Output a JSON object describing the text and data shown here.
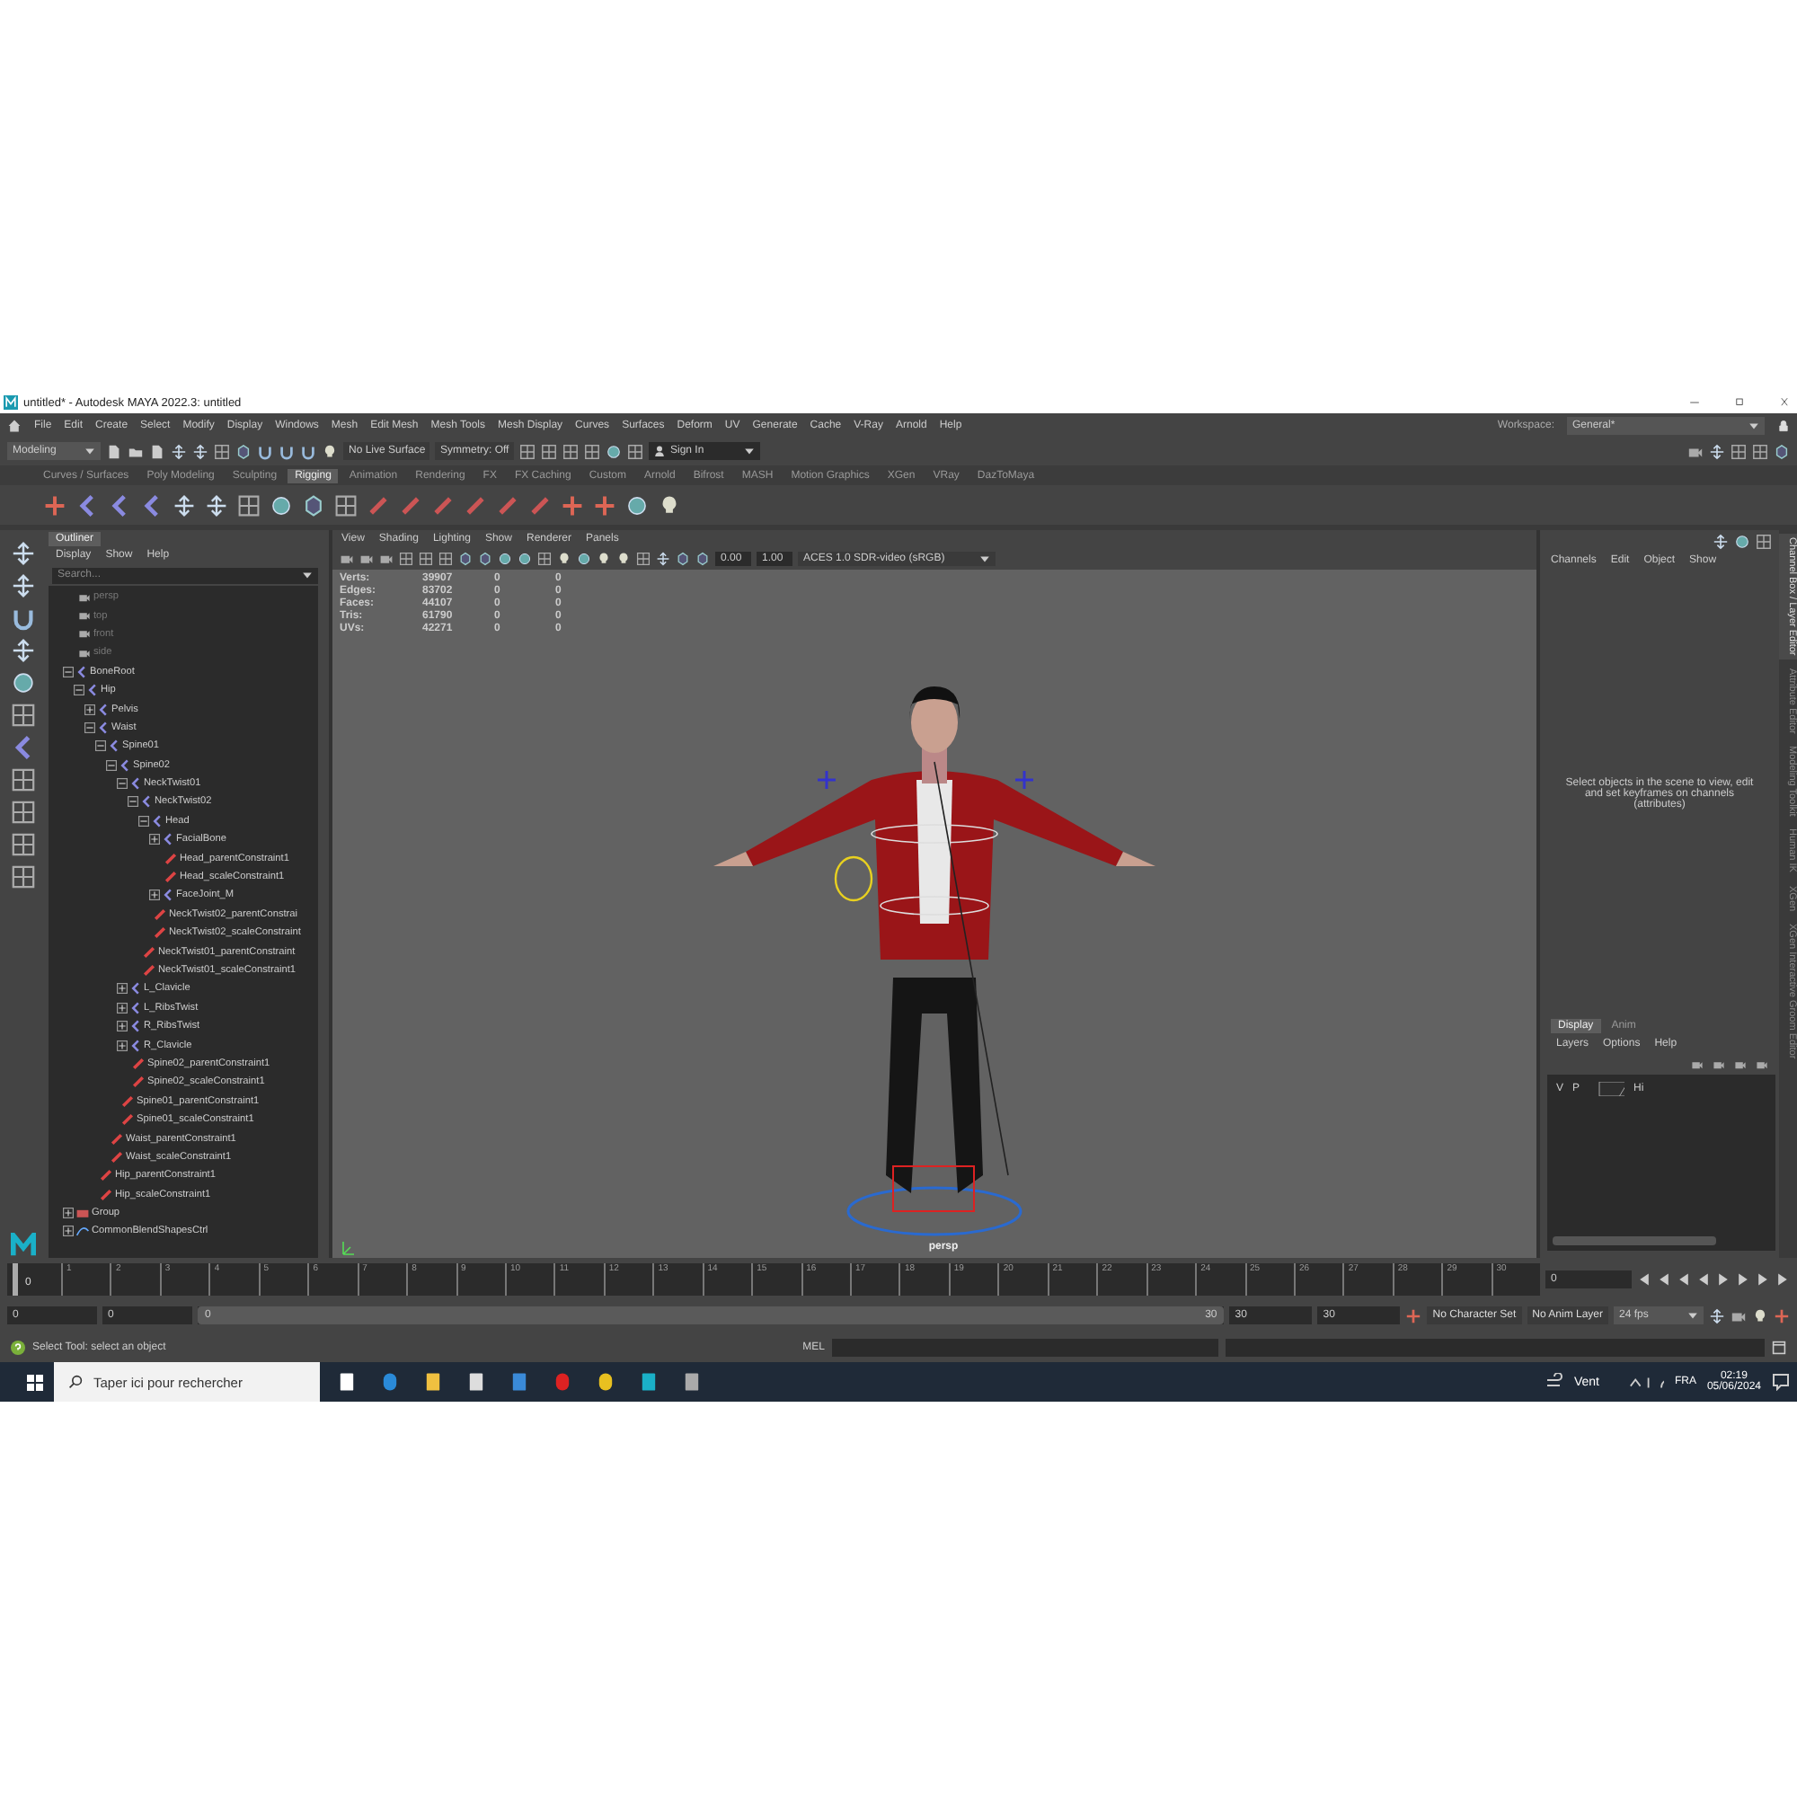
{
  "window": {
    "title": "untitled* - Autodesk MAYA 2022.3: untitled"
  },
  "menu_bar": [
    "File",
    "Edit",
    "Create",
    "Select",
    "Modify",
    "Display",
    "Windows",
    "Mesh",
    "Edit Mesh",
    "Mesh Tools",
    "Mesh Display",
    "Curves",
    "Surfaces",
    "Deform",
    "UV",
    "Generate",
    "Cache",
    "V-Ray",
    "Arnold",
    "Help"
  ],
  "workspace": {
    "label": "Workspace:",
    "value": "General*"
  },
  "status_line": {
    "menu_set": "Modeling",
    "live_surface": "No Live Surface",
    "symmetry": "Symmetry: Off",
    "sign_in": "Sign In"
  },
  "shelf_tabs": [
    {
      "label": "Curves / Surfaces",
      "selected": false
    },
    {
      "label": "Poly Modeling",
      "selected": false
    },
    {
      "label": "Sculpting",
      "selected": false
    },
    {
      "label": "Rigging",
      "selected": true
    },
    {
      "label": "Animation",
      "selected": false
    },
    {
      "label": "Rendering",
      "selected": false
    },
    {
      "label": "FX",
      "selected": false
    },
    {
      "label": "FX Caching",
      "selected": false
    },
    {
      "label": "Custom",
      "selected": false
    },
    {
      "label": "Arnold",
      "selected": false
    },
    {
      "label": "Bifrost",
      "selected": false
    },
    {
      "label": "MASH",
      "selected": false
    },
    {
      "label": "Motion Graphics",
      "selected": false
    },
    {
      "label": "XGen",
      "selected": false
    },
    {
      "label": "VRay",
      "selected": false
    },
    {
      "label": "DazToMaya",
      "selected": false
    }
  ],
  "outliner": {
    "title": "Outliner",
    "menus": [
      "Display",
      "Show",
      "Help"
    ],
    "search": {
      "placeholder": "Search..."
    },
    "tree": [
      {
        "label": "persp",
        "kind": "camera"
      },
      {
        "label": "top",
        "kind": "camera"
      },
      {
        "label": "front",
        "kind": "camera"
      },
      {
        "label": "side",
        "kind": "camera"
      },
      {
        "label": "BoneRoot",
        "kind": "joint",
        "expanded": true,
        "children": [
          {
            "label": "Hip",
            "kind": "joint",
            "expanded": true,
            "children": [
              {
                "label": "Pelvis",
                "kind": "joint",
                "expanded": false
              },
              {
                "label": "Waist",
                "kind": "joint",
                "expanded": true,
                "children": [
                  {
                    "label": "Spine01",
                    "kind": "joint",
                    "expanded": true,
                    "children": [
                      {
                        "label": "Spine02",
                        "kind": "joint",
                        "expanded": true,
                        "children": [
                          {
                            "label": "NeckTwist01",
                            "kind": "joint",
                            "expanded": true,
                            "children": [
                              {
                                "label": "NeckTwist02",
                                "kind": "joint",
                                "expanded": true,
                                "children": [
                                  {
                                    "label": "Head",
                                    "kind": "joint",
                                    "expanded": true,
                                    "children": [
                                      {
                                        "label": "FacialBone",
                                        "kind": "joint",
                                        "expanded": false
                                      },
                                      {
                                        "label": "Head_parentConstraint1",
                                        "kind": "constraint"
                                      },
                                      {
                                        "label": "Head_scaleConstraint1",
                                        "kind": "constraint"
                                      },
                                      {
                                        "label": "FaceJoint_M",
                                        "kind": "joint",
                                        "expanded": false
                                      }
                                    ]
                                  },
                                  {
                                    "label": "NeckTwist02_parentConstrai",
                                    "kind": "constraint"
                                  },
                                  {
                                    "label": "NeckTwist02_scaleConstraint",
                                    "kind": "constraint"
                                  }
                                ]
                              },
                              {
                                "label": "NeckTwist01_parentConstraint",
                                "kind": "constraint"
                              },
                              {
                                "label": "NeckTwist01_scaleConstraint1",
                                "kind": "constraint"
                              }
                            ]
                          },
                          {
                            "label": "L_Clavicle",
                            "kind": "joint",
                            "expanded": false
                          },
                          {
                            "label": "L_RibsTwist",
                            "kind": "joint",
                            "expanded": false
                          },
                          {
                            "label": "R_RibsTwist",
                            "kind": "joint",
                            "expanded": false
                          },
                          {
                            "label": "R_Clavicle",
                            "kind": "joint",
                            "expanded": false
                          },
                          {
                            "label": "Spine02_parentConstraint1",
                            "kind": "constraint"
                          },
                          {
                            "label": "Spine02_scaleConstraint1",
                            "kind": "constraint"
                          }
                        ]
                      },
                      {
                        "label": "Spine01_parentConstraint1",
                        "kind": "constraint"
                      },
                      {
                        "label": "Spine01_scaleConstraint1",
                        "kind": "constraint"
                      }
                    ]
                  },
                  {
                    "label": "Waist_parentConstraint1",
                    "kind": "constraint"
                  },
                  {
                    "label": "Waist_scaleConstraint1",
                    "kind": "constraint"
                  }
                ]
              },
              {
                "label": "Hip_parentConstraint1",
                "kind": "constraint"
              },
              {
                "label": "Hip_scaleConstraint1",
                "kind": "constraint"
              }
            ]
          }
        ]
      },
      {
        "label": "Group",
        "kind": "group",
        "expanded": false
      },
      {
        "label": "CommonBlendShapesCtrl",
        "kind": "curve",
        "expanded": false
      }
    ]
  },
  "viewport": {
    "menus": [
      "View",
      "Shading",
      "Lighting",
      "Show",
      "Renderer",
      "Panels"
    ],
    "exposure": "0.00",
    "gamma": "1.00",
    "color_space": "ACES 1.0 SDR-video (sRGB)",
    "hud": [
      {
        "label": "Verts:",
        "values": [
          "39907",
          "0",
          "0"
        ]
      },
      {
        "label": "Edges:",
        "values": [
          "83702",
          "0",
          "0"
        ]
      },
      {
        "label": "Faces:",
        "values": [
          "44107",
          "0",
          "0"
        ]
      },
      {
        "label": "Tris:",
        "values": [
          "61790",
          "0",
          "0"
        ]
      },
      {
        "label": "UVs:",
        "values": [
          "42271",
          "0",
          "0"
        ]
      }
    ],
    "camera": "persp"
  },
  "channel_box": {
    "menus": [
      "Channels",
      "Edit",
      "Object",
      "Show"
    ],
    "message": "Select objects in the scene to view, edit and set keyframes on channels (attributes)"
  },
  "layer_editor": {
    "tabs": [
      {
        "label": "Display",
        "selected": true
      },
      {
        "label": "Anim",
        "selected": false
      }
    ],
    "menus": [
      "Layers",
      "Options",
      "Help"
    ],
    "flags": [
      "V",
      "P"
    ],
    "layer": "Hi"
  },
  "side_tabs": [
    {
      "label": "Channel Box / Layer Editor",
      "selected": true
    },
    {
      "label": "Attribute Editor",
      "selected": false
    },
    {
      "label": "Modeling Toolkit",
      "selected": false
    },
    {
      "label": "Human IK",
      "selected": false
    },
    {
      "label": "XGen",
      "selected": false
    },
    {
      "label": "XGen Interactive Groom Editor",
      "selected": false
    }
  ],
  "timeline": {
    "level": 0,
    "ticks": [
      "1",
      "2",
      "3",
      "4",
      "5",
      "6",
      "7",
      "8",
      "9",
      "10",
      "11",
      "12",
      "13",
      "14",
      "15",
      "16",
      "17",
      "18",
      "19",
      "20",
      "21",
      "22",
      "23",
      "24",
      "25",
      "26",
      "27",
      "28",
      "29",
      "30"
    ],
    "marker": "0",
    "current_frame": "0"
  },
  "range": {
    "level": 1,
    "start": "0",
    "playback_start": "0",
    "slider_start": "0",
    "slider_end": "30",
    "playback_end": "30",
    "end": "30",
    "character_set": "No Character Set",
    "anim_layer": "No Anim Layer",
    "fps": "24 fps"
  },
  "help_line": "Select Tool: select an object",
  "command_line": {
    "label": "MEL"
  },
  "taskbar": {
    "search_placeholder": "Taper ici pour rechercher",
    "weather": "Vent",
    "language": "FRA",
    "time": "02:19",
    "date": "05/06/2024"
  }
}
